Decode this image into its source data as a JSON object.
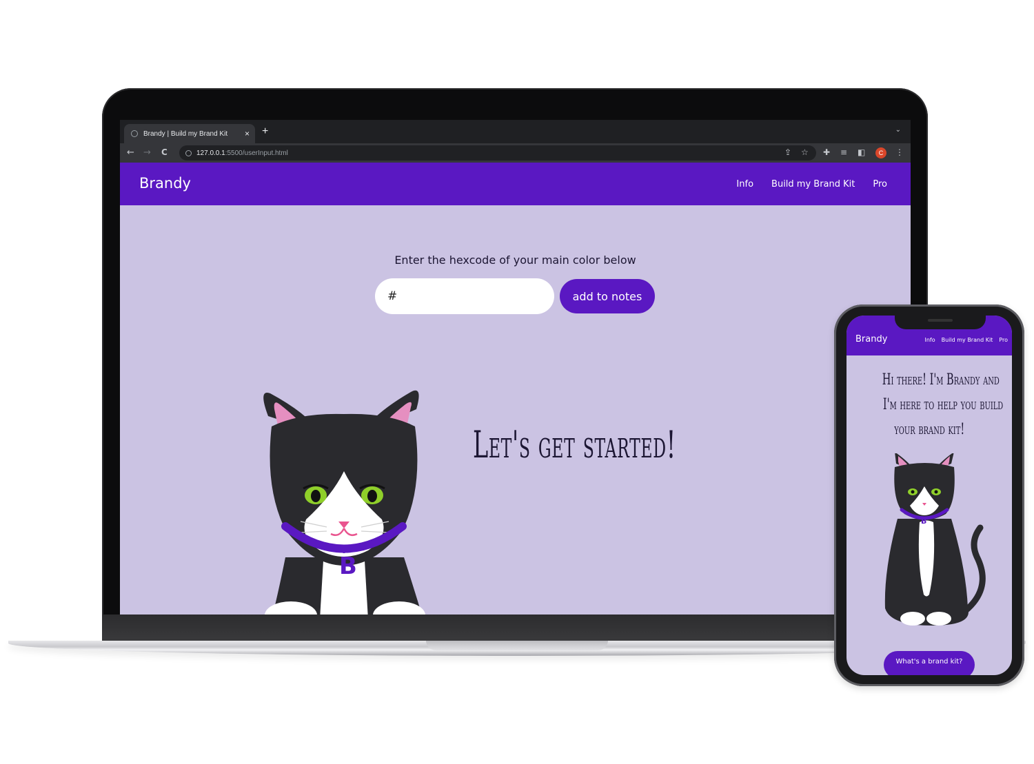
{
  "browser": {
    "tab_title": "Brandy | Build my Brand Kit",
    "tab_close": "×",
    "new_tab": "+",
    "dropdown": "⌄",
    "url_host": "127.0.0.1",
    "url_path": ":5500/userInput.html",
    "back": "←",
    "forward": "→",
    "reload": "C",
    "profile_initial": "C"
  },
  "site": {
    "brand": "Brandy",
    "nav": [
      "Info",
      "Build my Brand Kit",
      "Pro"
    ]
  },
  "main": {
    "prompt": "Enter the hexcode of your main color below",
    "hex_placeholder": "#",
    "add_button": "add to notes",
    "headline": "Let's get started!",
    "collar_letter": "B"
  },
  "mobile": {
    "brand": "Brandy",
    "nav": [
      "Info",
      "Build my Brand Kit",
      "Pro"
    ],
    "heading_lines": [
      "Hi there! I'm Brandy and",
      "I'm here to help you build",
      "your brand kit!"
    ],
    "cta_button": "What's a brand kit?",
    "collar_letter": "B"
  },
  "colors": {
    "brand_purple": "#5a18c2",
    "page_lavender": "#cbc3e3",
    "cat_black": "#2a2a2e",
    "cat_ear_pink": "#e58fc0",
    "cat_eye_green": "#8fcf2a"
  },
  "icons": [
    "globe-icon",
    "info-icon",
    "share-icon",
    "star-icon",
    "extensions-icon",
    "media-icon",
    "sidepanel-icon",
    "menu-icon"
  ]
}
